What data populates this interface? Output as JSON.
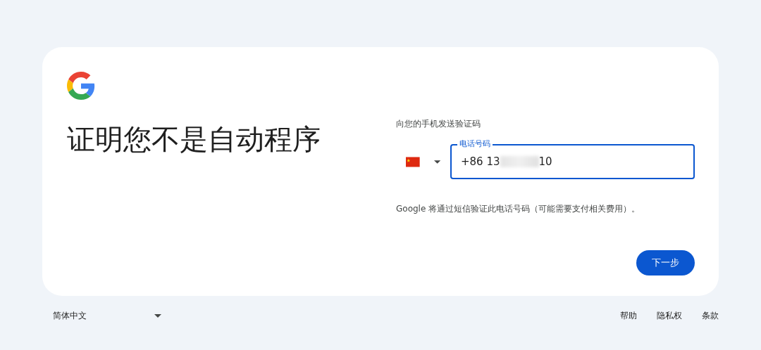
{
  "title": "证明您不是自动程序",
  "prompt": "向您的手机发送验证码",
  "phone": {
    "label": "电话号码",
    "value_start": "+86 13",
    "value_end": "10",
    "focused": true
  },
  "notice": "Google 将通过短信验证此电话号码（可能需要支付相关费用）。",
  "next_button": "下一步",
  "footer": {
    "language": "简体中文",
    "links": [
      "帮助",
      "隐私权",
      "条款"
    ]
  }
}
